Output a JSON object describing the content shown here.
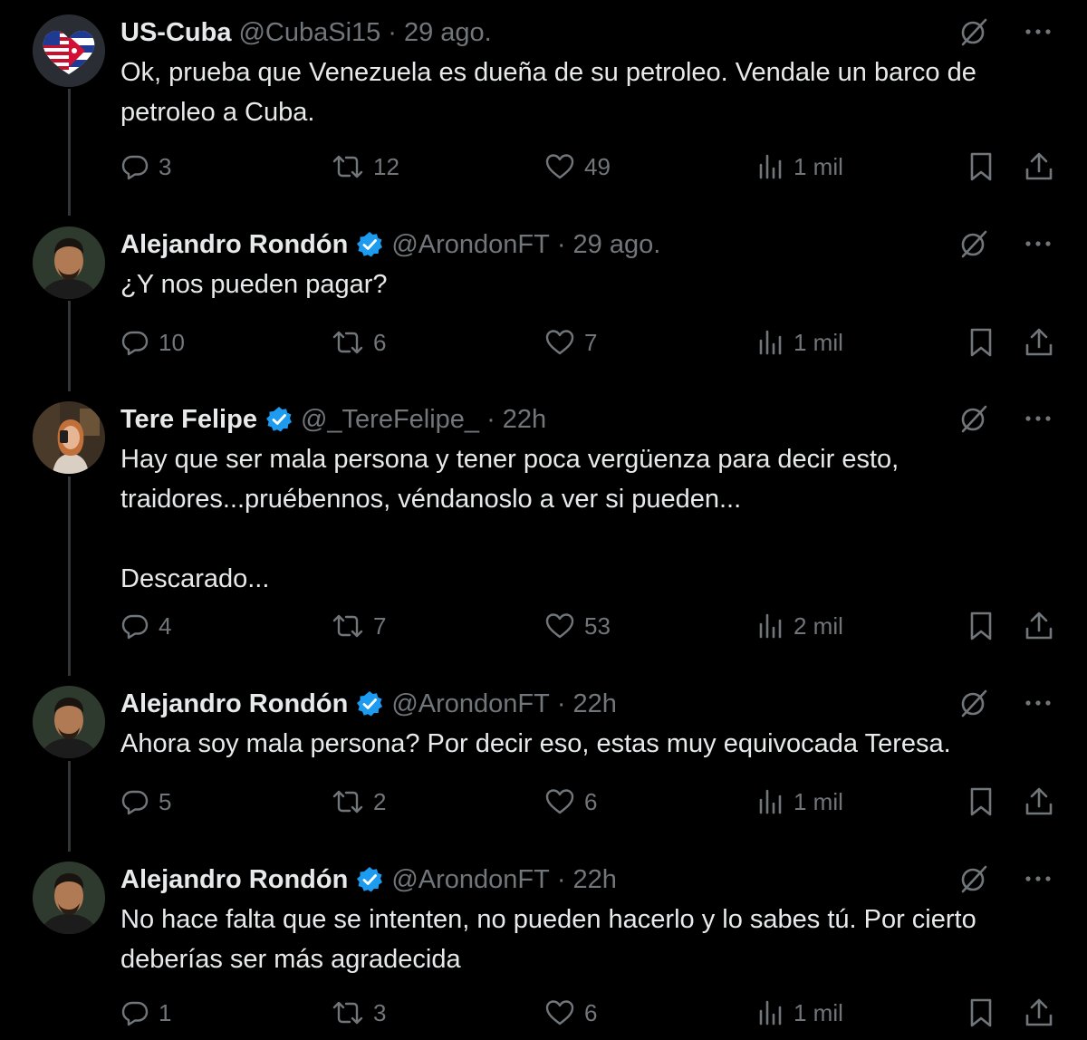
{
  "tweets": [
    {
      "name": "US-Cuba",
      "verified": false,
      "handle": "@CubaSi15",
      "time": "29 ago.",
      "text": "Ok, prueba que Venezuela es dueña de su petroleo. Vendale un barco de petroleo a Cuba.",
      "replies": "3",
      "retweets": "12",
      "likes": "49",
      "views": "1 mil",
      "avatar": "us-cuba-flag-heart"
    },
    {
      "name": "Alejandro Rondón",
      "verified": true,
      "handle": "@ArondonFT",
      "time": "29 ago.",
      "text": "¿Y nos pueden pagar?",
      "replies": "10",
      "retweets": "6",
      "likes": "7",
      "views": "1 mil",
      "avatar": "man-portrait"
    },
    {
      "name": "Tere Felipe",
      "verified": true,
      "handle": "@_TereFelipe_",
      "time": "22h",
      "text": "Hay que ser mala persona y tener poca vergüenza para decir esto,\ntraidores...pruébennos, véndanoslo a ver si pueden...\n\nDescarado...",
      "replies": "4",
      "retweets": "7",
      "likes": "53",
      "views": "2 mil",
      "avatar": "woman-selfie"
    },
    {
      "name": "Alejandro Rondón",
      "verified": true,
      "handle": "@ArondonFT",
      "time": "22h",
      "text": "Ahora soy mala persona? Por decir eso, estas muy equivocada Teresa.",
      "replies": "5",
      "retweets": "2",
      "likes": "6",
      "views": "1 mil",
      "avatar": "man-portrait"
    },
    {
      "name": "Alejandro Rondón",
      "verified": true,
      "handle": "@ArondonFT",
      "time": "22h",
      "text": "No hace falta que se intenten, no pueden hacerlo y lo sabes tú. Por cierto\ndeberías ser más agradecida",
      "replies": "1",
      "retweets": "3",
      "likes": "6",
      "views": "1 mil",
      "avatar": "man-portrait"
    }
  ],
  "separator": "·",
  "colors": {
    "background": "#000000",
    "text": "#e7e9ea",
    "secondary": "#71767b",
    "verified": "#1d9bf0",
    "thread_line": "#333639"
  },
  "icons": [
    "reply-icon",
    "retweet-icon",
    "like-icon",
    "views-icon",
    "bookmark-icon",
    "share-icon",
    "grok-icon",
    "more-icon",
    "verified-badge-icon"
  ]
}
